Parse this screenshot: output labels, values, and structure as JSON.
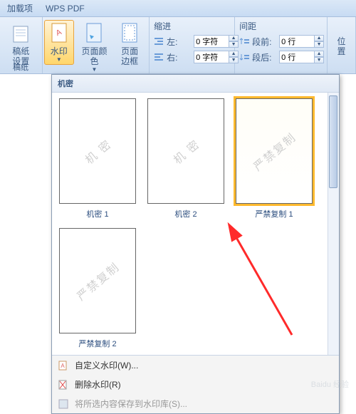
{
  "tabs": {
    "addins": "加载项",
    "wpspdf": "WPS PDF"
  },
  "ribbon": {
    "paper": "稿纸\n设置",
    "watermark": "水印",
    "pagecolor": "页面颜色",
    "pageborder": "页面\n边框",
    "group_paper": "稿纸",
    "indent_title": "缩进",
    "spacing_title": "间距",
    "left_label": "左:",
    "right_label": "右:",
    "before_label": "段前:",
    "after_label": "段后:",
    "chars": "0 字符",
    "lines": "0 行",
    "position": "位置"
  },
  "dropdown": {
    "header": "机密",
    "items": [
      {
        "wm": "机 密",
        "caption": "机密 1",
        "selected": false
      },
      {
        "wm": "机 密",
        "caption": "机密 2",
        "selected": false
      },
      {
        "wm": "严禁复制",
        "caption": "严禁复制 1",
        "selected": true
      },
      {
        "wm": "严禁复制",
        "caption": "严禁复制 2",
        "selected": false
      }
    ],
    "menu": {
      "custom": "自定义水印(W)...",
      "remove": "删除水印(R)",
      "save": "将所选内容保存到水印库(S)..."
    }
  }
}
